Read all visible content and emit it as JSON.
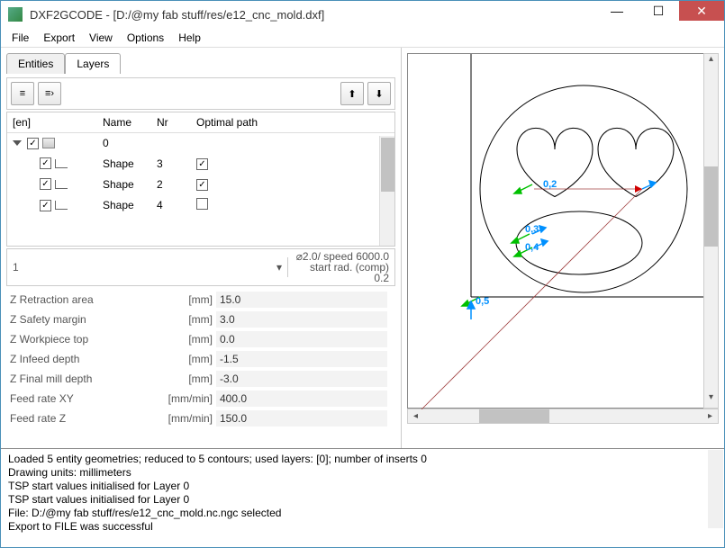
{
  "titlebar": {
    "title": "DXF2GCODE - [D:/@my fab stuff/res/e12_cnc_mold.dxf]"
  },
  "menu": {
    "file": "File",
    "export": "Export",
    "view": "View",
    "options": "Options",
    "help": "Help"
  },
  "tabs": {
    "entities": "Entities",
    "layers": "Layers"
  },
  "tree": {
    "head": {
      "c1": "[en]",
      "c2": "Name",
      "c3": "Nr",
      "c4": "Optimal path"
    },
    "rows": [
      {
        "indent": 0,
        "expand": true,
        "check": true,
        "icon": "layer",
        "name": "0",
        "nr": "",
        "opt": ""
      },
      {
        "indent": 1,
        "expand": false,
        "check": true,
        "icon": "shape",
        "name": "Shape",
        "nr": "3",
        "opt": "check"
      },
      {
        "indent": 1,
        "expand": false,
        "check": true,
        "icon": "shape",
        "name": "Shape",
        "nr": "2",
        "opt": "check"
      },
      {
        "indent": 1,
        "expand": false,
        "check": true,
        "icon": "shape",
        "name": "Shape",
        "nr": "4",
        "opt": ""
      }
    ]
  },
  "selector": {
    "value": "1",
    "info1": "⌀2.0/ speed 6000.0",
    "info2": "start rad. (comp) 0.2"
  },
  "params": [
    {
      "lbl": "Z Retraction area",
      "unit": "[mm]",
      "val": "15.0"
    },
    {
      "lbl": "Z Safety margin",
      "unit": "[mm]",
      "val": "3.0"
    },
    {
      "lbl": "Z Workpiece top",
      "unit": "[mm]",
      "val": "0.0"
    },
    {
      "lbl": "Z Infeed depth",
      "unit": "[mm]",
      "val": "-1.5"
    },
    {
      "lbl": "Z Final mill depth",
      "unit": "[mm]",
      "val": "-3.0"
    },
    {
      "lbl": "Feed rate XY",
      "unit": "[mm/min]",
      "val": "400.0"
    },
    {
      "lbl": "Feed rate Z",
      "unit": "[mm/min]",
      "val": "150.0"
    }
  ],
  "canvas": {
    "labels": [
      "0,2",
      "0,3",
      "0,4",
      "0,5"
    ]
  },
  "log": [
    "Loaded 5 entity geometries; reduced to 5 contours; used layers: [0]; number of inserts 0",
    "Drawing units: millimeters",
    "TSP start values initialised for Layer 0",
    "TSP start values initialised for Layer 0",
    "File: D:/@my fab stuff/res/e12_cnc_mold.nc.ngc selected",
    "Export to FILE was successful"
  ]
}
